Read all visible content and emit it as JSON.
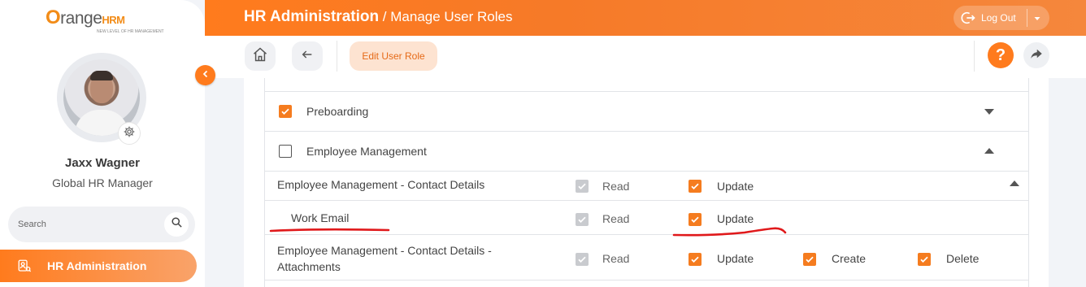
{
  "sidebar": {
    "logo": {
      "brand": "OrangeHRM",
      "brand_o": "O",
      "brand_mid": "range",
      "brand_hrm": "HRM",
      "tagline": "NEW LEVEL OF HR MANAGEMENT"
    },
    "user": {
      "name": "Jaxx Wagner",
      "role": "Global HR Manager"
    },
    "search": {
      "placeholder": "Search"
    },
    "active_nav": {
      "label": "HR Administration"
    }
  },
  "header": {
    "title_main": "HR Administration",
    "title_sep": " / ",
    "title_sub": "Manage User Roles",
    "logout_label": "Log Out"
  },
  "toolbar": {
    "edit_role_label": "Edit User Role",
    "help_label": "?"
  },
  "permissions": {
    "modules": [
      {
        "label": "Preboarding",
        "checked": true,
        "expanded": false
      },
      {
        "label": "Employee Management",
        "checked": false,
        "expanded": true
      }
    ],
    "rows": [
      {
        "label": "Employee Management - Contact Details",
        "read_label": "Read",
        "read": true,
        "update_label": "Update",
        "update": true
      },
      {
        "label": "Work Email",
        "read_label": "Read",
        "read": true,
        "update_label": "Update",
        "update": true
      },
      {
        "label_line1": "Employee Management - Contact Details -",
        "label_line2": "Attachments",
        "read_label": "Read",
        "read": true,
        "update_label": "Update",
        "update": true,
        "create_label": "Create",
        "create": true,
        "delete_label": "Delete",
        "delete": true
      }
    ]
  },
  "colors": {
    "accent": "#ff7b1d",
    "annotation": "#e0191b"
  }
}
